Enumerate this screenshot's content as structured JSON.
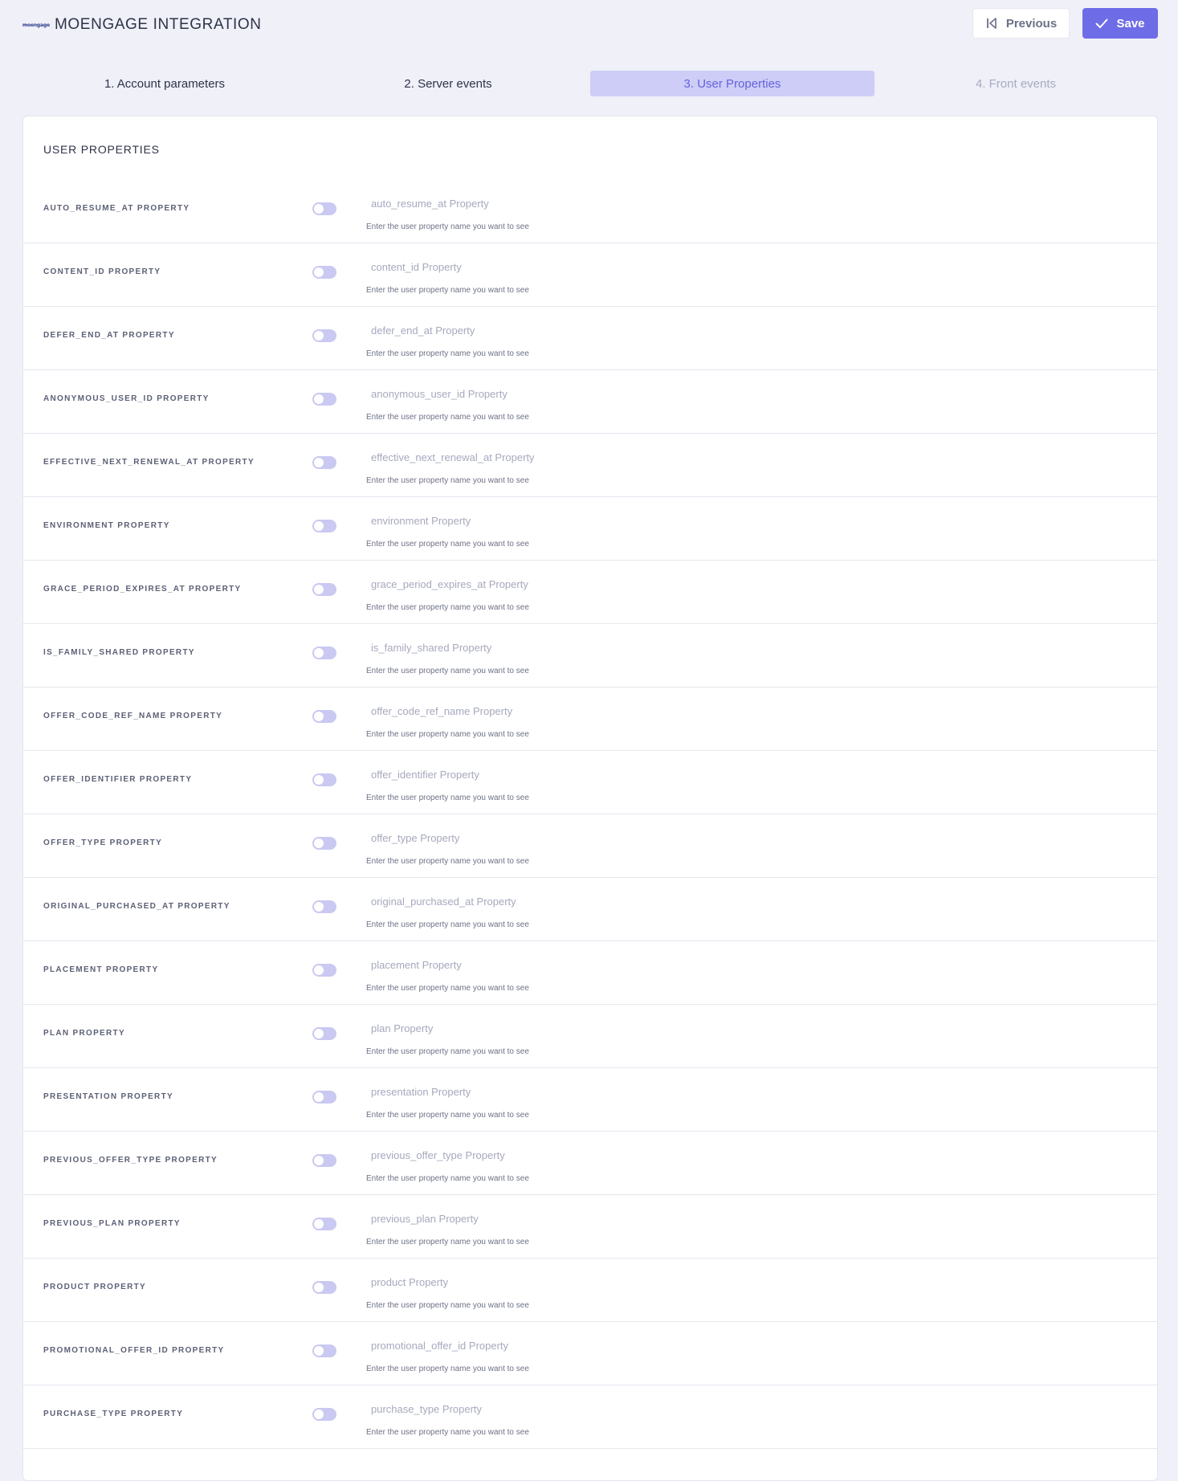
{
  "header": {
    "logo": "moengage",
    "title": "MOENGAGE INTEGRATION",
    "previous_label": "Previous",
    "save_label": "Save"
  },
  "steps": [
    {
      "label": "1. Account parameters",
      "state": "done"
    },
    {
      "label": "2. Server events",
      "state": "done"
    },
    {
      "label": "3. User Properties",
      "state": "active"
    },
    {
      "label": "4. Front events",
      "state": "todo"
    }
  ],
  "section": {
    "title": "USER PROPERTIES"
  },
  "helper_text": "Enter the user property name you want to see",
  "properties": [
    {
      "label": "AUTO_RESUME_AT PROPERTY",
      "placeholder": "auto_resume_at Property",
      "value": "",
      "enabled": false
    },
    {
      "label": "CONTENT_ID PROPERTY",
      "placeholder": "content_id Property",
      "value": "",
      "enabled": false
    },
    {
      "label": "DEFER_END_AT PROPERTY",
      "placeholder": "defer_end_at Property",
      "value": "",
      "enabled": false
    },
    {
      "label": "ANONYMOUS_USER_ID PROPERTY",
      "placeholder": "anonymous_user_id Property",
      "value": "",
      "enabled": false
    },
    {
      "label": "EFFECTIVE_NEXT_RENEWAL_AT PROPERTY",
      "placeholder": "effective_next_renewal_at Property",
      "value": "",
      "enabled": false
    },
    {
      "label": "ENVIRONMENT PROPERTY",
      "placeholder": "environment Property",
      "value": "",
      "enabled": false
    },
    {
      "label": "GRACE_PERIOD_EXPIRES_AT PROPERTY",
      "placeholder": "grace_period_expires_at Property",
      "value": "",
      "enabled": false
    },
    {
      "label": "IS_FAMILY_SHARED PROPERTY",
      "placeholder": "is_family_shared Property",
      "value": "",
      "enabled": false
    },
    {
      "label": "OFFER_CODE_REF_NAME PROPERTY",
      "placeholder": "offer_code_ref_name Property",
      "value": "",
      "enabled": false
    },
    {
      "label": "OFFER_IDENTIFIER PROPERTY",
      "placeholder": "offer_identifier Property",
      "value": "",
      "enabled": false
    },
    {
      "label": "OFFER_TYPE PROPERTY",
      "placeholder": "offer_type Property",
      "value": "",
      "enabled": false
    },
    {
      "label": "ORIGINAL_PURCHASED_AT PROPERTY",
      "placeholder": "original_purchased_at Property",
      "value": "",
      "enabled": false
    },
    {
      "label": "PLACEMENT PROPERTY",
      "placeholder": "placement Property",
      "value": "",
      "enabled": false
    },
    {
      "label": "PLAN PROPERTY",
      "placeholder": "plan Property",
      "value": "",
      "enabled": false
    },
    {
      "label": "PRESENTATION PROPERTY",
      "placeholder": "presentation Property",
      "value": "",
      "enabled": false
    },
    {
      "label": "PREVIOUS_OFFER_TYPE PROPERTY",
      "placeholder": "previous_offer_type Property",
      "value": "",
      "enabled": false
    },
    {
      "label": "PREVIOUS_PLAN PROPERTY",
      "placeholder": "previous_plan Property",
      "value": "",
      "enabled": false
    },
    {
      "label": "PRODUCT PROPERTY",
      "placeholder": "product Property",
      "value": "",
      "enabled": false
    },
    {
      "label": "PROMOTIONAL_OFFER_ID PROPERTY",
      "placeholder": "promotional_offer_id Property",
      "value": "",
      "enabled": false
    },
    {
      "label": "PURCHASE_TYPE PROPERTY",
      "placeholder": "purchase_type Property",
      "value": "",
      "enabled": false
    }
  ]
}
